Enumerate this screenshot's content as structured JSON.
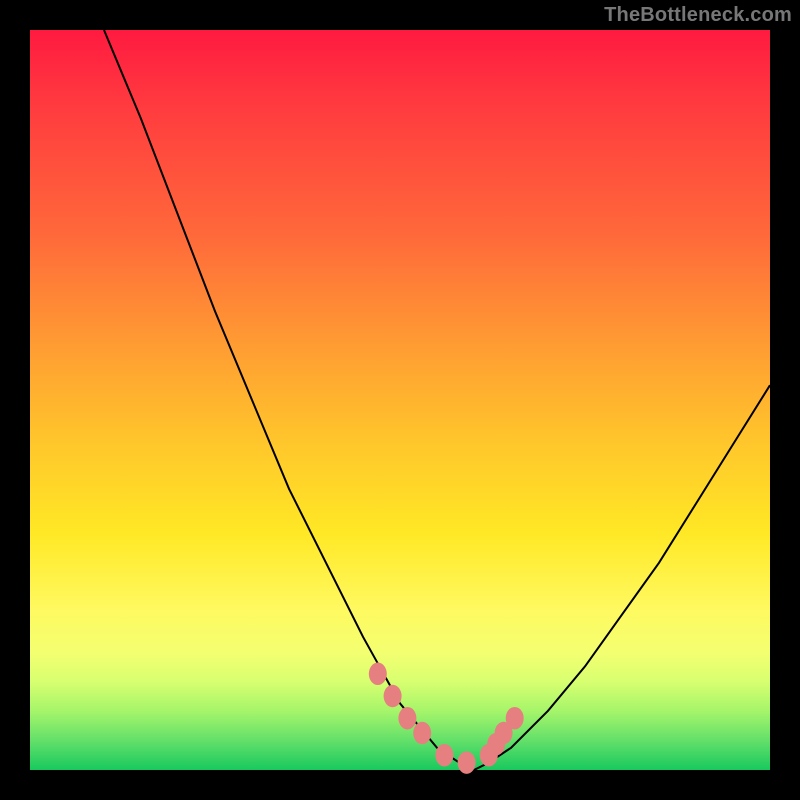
{
  "watermark": "TheBottleneck.com",
  "colors": {
    "frame": "#000000",
    "curve": "#000000",
    "marker_fill": "#e68080",
    "gradient_top": "#ff1a40",
    "gradient_bottom": "#18c95e"
  },
  "chart_data": {
    "type": "line",
    "title": "",
    "xlabel": "",
    "ylabel": "",
    "xlim": [
      0,
      100
    ],
    "ylim": [
      0,
      100
    ],
    "note": "V-shaped bottleneck curve; y-axis ≈ bottleneck %, minimum ≈ 0 around x ≈ 55–62; values estimated from pixels",
    "series": [
      {
        "name": "bottleneck-curve",
        "x": [
          10,
          15,
          20,
          25,
          30,
          35,
          40,
          45,
          50,
          55,
          58,
          60,
          62,
          65,
          70,
          75,
          80,
          85,
          90,
          95,
          100
        ],
        "values": [
          100,
          88,
          75,
          62,
          50,
          38,
          28,
          18,
          9,
          3,
          1,
          0,
          1,
          3,
          8,
          14,
          21,
          28,
          36,
          44,
          52
        ]
      }
    ],
    "markers": {
      "name": "highlighted-points",
      "color": "#e68080",
      "x": [
        47,
        49,
        51,
        53,
        56,
        59,
        62,
        63,
        64,
        65.5
      ],
      "values": [
        13,
        10,
        7,
        5,
        2,
        1,
        2,
        3.5,
        5,
        7
      ]
    }
  }
}
